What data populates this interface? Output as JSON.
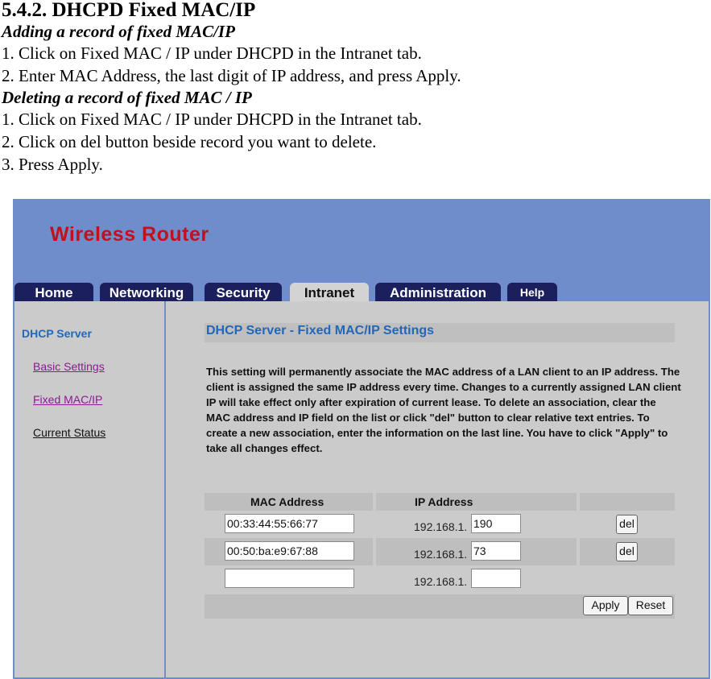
{
  "document": {
    "heading": "5.4.2. DHCPD Fixed MAC/IP",
    "adding_title": "Adding a record of fixed MAC/IP",
    "adding_steps": [
      "1. Click on Fixed MAC / IP under DHCPD in the Intranet tab.",
      "2. Enter MAC Address, the last digit of IP address, and press Apply."
    ],
    "deleting_title": "Deleting a record of fixed MAC / IP",
    "deleting_steps": [
      "1. Click on Fixed MAC / IP under DHCPD in the Intranet tab.",
      "2. Click on del button beside record you want to delete.",
      "3. Press Apply."
    ]
  },
  "router": {
    "logo": "Wireless Router",
    "colors": {
      "header": "#6f8dca",
      "tab": "#1b1f5e",
      "logo": "#c2101d",
      "accent": "#2367b8",
      "visited_link": "#8b1a8f"
    },
    "tabs": [
      {
        "label": "Home",
        "active": false
      },
      {
        "label": "Networking",
        "active": false
      },
      {
        "label": "Security",
        "active": false
      },
      {
        "label": "Intranet",
        "active": true
      },
      {
        "label": "Administration",
        "active": false
      },
      {
        "label": "Help",
        "active": false
      }
    ],
    "sidebar": {
      "title": "DHCP Server",
      "items": [
        {
          "label": "Basic Settings"
        },
        {
          "label": "Fixed MAC/IP"
        },
        {
          "label": "Current Status"
        }
      ]
    },
    "content": {
      "title": "DHCP Server - Fixed MAC/IP Settings",
      "description": "This setting will permanently associate the MAC address of a LAN client to an IP address. The client is assigned the same IP address every time. Changes to a currently assigned LAN client IP will take effect only after expiration of current lease. To delete an association, clear the MAC address and IP field on the list or click \"del\" button to clear relative text entries. To create a new association, enter the information on the last line. You have to click \"Apply\" to take all changes effect.",
      "table": {
        "headers": [
          "MAC Address",
          "IP Address",
          ""
        ],
        "ip_prefix": "192.168.1.",
        "rows": [
          {
            "mac": "00:33:44:55:66:77",
            "ip_last": "190",
            "del": "del"
          },
          {
            "mac": "00:50:ba:e9:67:88",
            "ip_last": "73",
            "del": "del"
          },
          {
            "mac": "",
            "ip_last": ""
          }
        ]
      },
      "apply_label": "Apply",
      "reset_label": "Reset"
    }
  }
}
